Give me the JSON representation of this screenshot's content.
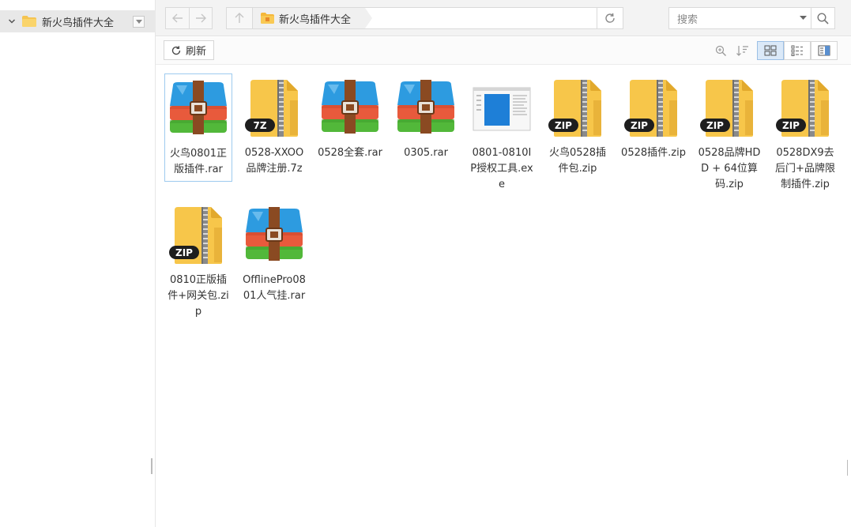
{
  "sidebar": {
    "items": [
      {
        "label": "新火鸟插件大全",
        "icon": "folder-icon",
        "expanded": true
      }
    ]
  },
  "address_bar": {
    "path": "新火鸟插件大全"
  },
  "search": {
    "placeholder": "搜索"
  },
  "toolbar": {
    "refresh_label": "刷新",
    "active_view": "large-icons"
  },
  "files": [
    {
      "name": "火鸟0801正版插件.rar",
      "type": "rar",
      "selected": true
    },
    {
      "name": "0528-XXOO品牌注册.7z",
      "type": "7z",
      "badge": "7Z"
    },
    {
      "name": "0528全套.rar",
      "type": "rar"
    },
    {
      "name": "0305.rar",
      "type": "rar"
    },
    {
      "name": "0801-0810IP授权工具.exe",
      "type": "exe"
    },
    {
      "name": "火鸟0528插件包.zip",
      "type": "zip",
      "badge": "ZIP"
    },
    {
      "name": "0528插件.zip",
      "type": "zip",
      "badge": "ZIP"
    },
    {
      "name": "0528品牌HDD + 64位算码.zip",
      "type": "zip",
      "badge": "ZIP"
    },
    {
      "name": "0528DX9去后门+品牌限制插件.zip",
      "type": "zip",
      "badge": "ZIP"
    },
    {
      "name": "0810正版插件+网关包.zip",
      "type": "zip",
      "badge": "ZIP"
    },
    {
      "name": "OfflinePro0801人气挂.rar",
      "type": "rar"
    }
  ],
  "colors": {
    "folder_yellow": "#f7c64a",
    "rar_blue": "#2d9be0",
    "rar_red": "#e85a3c",
    "rar_green": "#52b83a",
    "strap_brown": "#8a4a22",
    "selection_border": "#9ecbef"
  }
}
